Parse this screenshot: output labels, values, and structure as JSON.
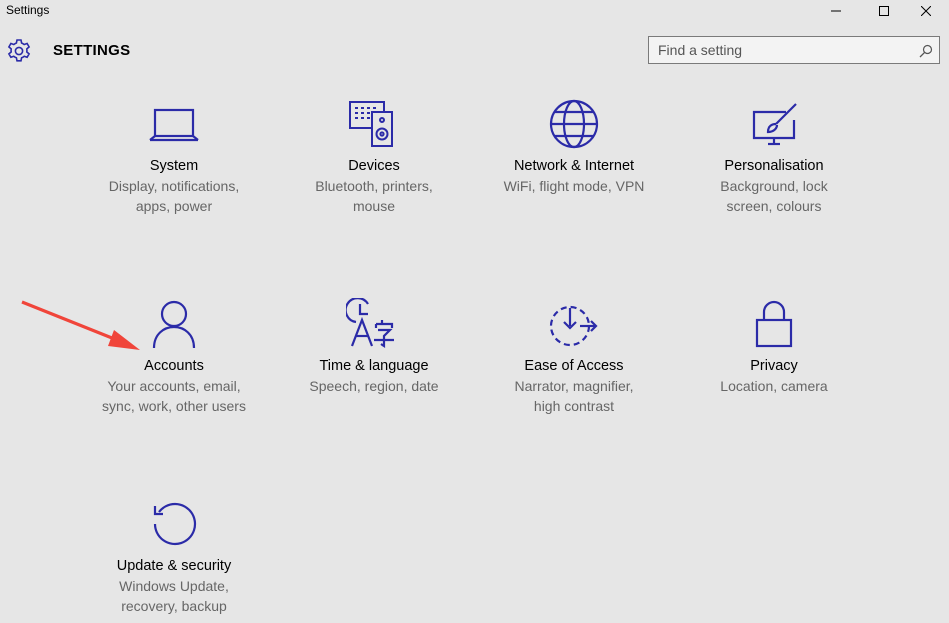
{
  "window": {
    "title": "Settings",
    "controls": [
      "minimize",
      "maximize",
      "close"
    ]
  },
  "header": {
    "icon": "gear-icon",
    "title": "SETTINGS"
  },
  "search": {
    "placeholder": "Find a setting",
    "value": ""
  },
  "colors": {
    "accent": "#2b2ba8",
    "background": "#e6e6e6",
    "arrow": "#f0453a"
  },
  "tiles": [
    {
      "name": "System",
      "description": "Display, notifications,\napps, power",
      "icon": "laptop-icon"
    },
    {
      "name": "Devices",
      "description": "Bluetooth, printers,\nmouse",
      "icon": "devices-icon"
    },
    {
      "name": "Network & Internet",
      "description": "WiFi, flight mode, VPN",
      "icon": "globe-icon"
    },
    {
      "name": "Personalisation",
      "description": "Background, lock\nscreen, colours",
      "icon": "paintbrush-icon"
    },
    {
      "name": "Accounts",
      "description": "Your accounts, email,\nsync, work, other users",
      "icon": "person-icon"
    },
    {
      "name": "Time & language",
      "description": "Speech, region, date",
      "icon": "time-language-icon"
    },
    {
      "name": "Ease of Access",
      "description": "Narrator, magnifier,\nhigh contrast",
      "icon": "ease-of-access-icon"
    },
    {
      "name": "Privacy",
      "description": "Location, camera",
      "icon": "lock-icon"
    },
    {
      "name": "Update & security",
      "description": "Windows Update,\nrecovery, backup",
      "icon": "refresh-icon"
    }
  ]
}
